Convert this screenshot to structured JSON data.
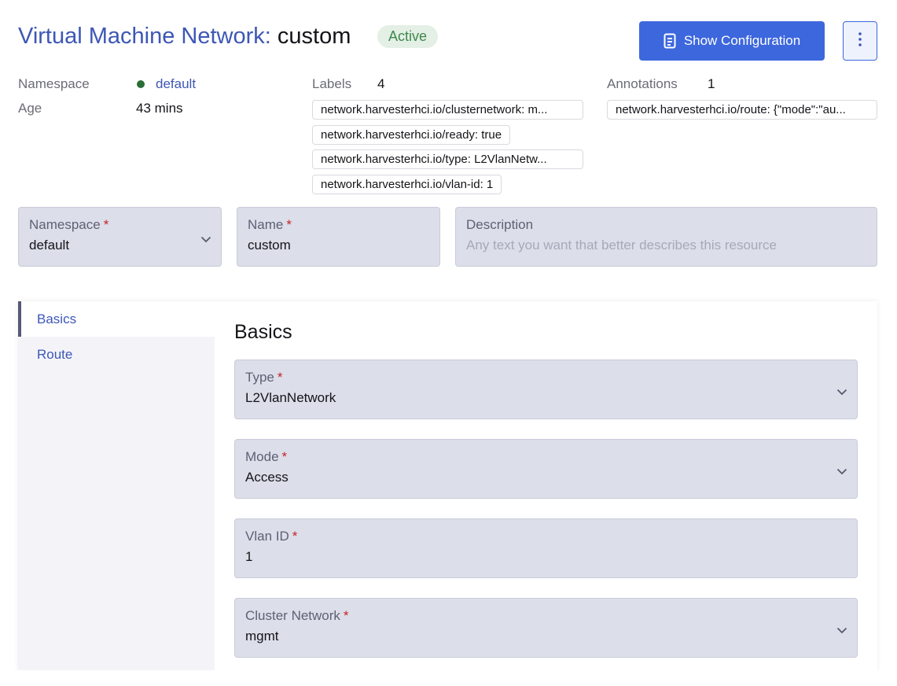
{
  "header": {
    "resource_type": "Virtual Machine Network:",
    "resource_name": "custom",
    "status": "Active",
    "show_config_label": "Show Configuration"
  },
  "meta": {
    "namespace_label": "Namespace",
    "namespace_value": "default",
    "age_label": "Age",
    "age_value": "43 mins",
    "labels_label": "Labels",
    "labels_count": "4",
    "labels": [
      "network.harvesterhci.io/clusternetwork: m...",
      "network.harvesterhci.io/ready: true",
      "network.harvesterhci.io/type: L2VlanNetw...",
      "network.harvesterhci.io/vlan-id: 1"
    ],
    "annotations_label": "Annotations",
    "annotations_count": "1",
    "annotations": [
      "network.harvesterhci.io/route: {\"mode\":\"au..."
    ]
  },
  "form": {
    "namespace": {
      "label": "Namespace",
      "required": "*",
      "value": "default"
    },
    "name": {
      "label": "Name",
      "required": "*",
      "value": "custom"
    },
    "description": {
      "label": "Description",
      "placeholder": "Any text you want that better describes this resource"
    }
  },
  "tabs": {
    "items": [
      {
        "label": "Basics"
      },
      {
        "label": "Route"
      }
    ]
  },
  "basics": {
    "title": "Basics",
    "type": {
      "label": "Type",
      "required": "*",
      "value": "L2VlanNetwork"
    },
    "mode": {
      "label": "Mode",
      "required": "*",
      "value": "Access"
    },
    "vlan_id": {
      "label": "Vlan ID",
      "required": "*",
      "value": "1"
    },
    "cluster_network": {
      "label": "Cluster Network",
      "required": "*",
      "value": "mgmt"
    }
  },
  "colors": {
    "primary": "#3d67dd",
    "link": "#3d57b5",
    "active_badge_bg": "#e4efe6",
    "active_badge_text": "#3d8a4a",
    "field_bg": "#dcdee9",
    "required": "#c4242a"
  }
}
